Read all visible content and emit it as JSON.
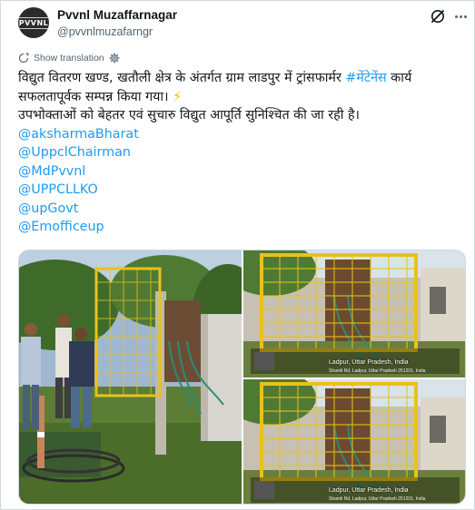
{
  "author": {
    "display_name": "Pvvnl Muzaffarnagar",
    "handle": "@pvvnlmuzafarngr",
    "avatar_text": "PVVNL",
    "avatar_icon": "pvvnl-logo"
  },
  "header_icons": {
    "grok": "grok-icon",
    "more": "more-icon"
  },
  "translate": {
    "label": "Show translation",
    "icon": "translate-icon",
    "settings_icon": "gear-icon"
  },
  "tweet": {
    "line1_prefix": "विद्युत वितरण खण्ड, खतौली क्षेत्र के अंतर्गत ग्राम लाडपुर में ट्रांसफार्मर ",
    "hashtag": "#मेंटेनेंस",
    "line1_suffix": " कार्य",
    "line2": "सफलतापूर्वक सम्पन्न किया गया। ",
    "emoji": "⚡",
    "line3": "उपभोक्ताओं को बेहतर एवं सुचारु विद्युत आपूर्ति सुनिश्चित की जा रही है।",
    "mentions": [
      "@aksharmaBharat",
      "@UppclChairman",
      "@MdPvvnl",
      "@UPPCLLKO",
      "@upGovt",
      "@Emofficeup"
    ]
  },
  "media": {
    "geo_top": "Ladpur, Uttar Pradesh, India",
    "geo_top_sub": "Shamli Rd, Ladpur, Uttar Pradesh 251201, India",
    "geo_bottom": "Ladpur, Uttar Pradesh, India",
    "geo_bottom_sub": "Shamli Rd, Ladpur, Uttar Pradesh 251201, India"
  },
  "colors": {
    "link": "#1d9bf0",
    "text": "#0f1419",
    "muted": "#536471",
    "border": "#cfd9de",
    "fence_yellow": "#e8c21a"
  }
}
